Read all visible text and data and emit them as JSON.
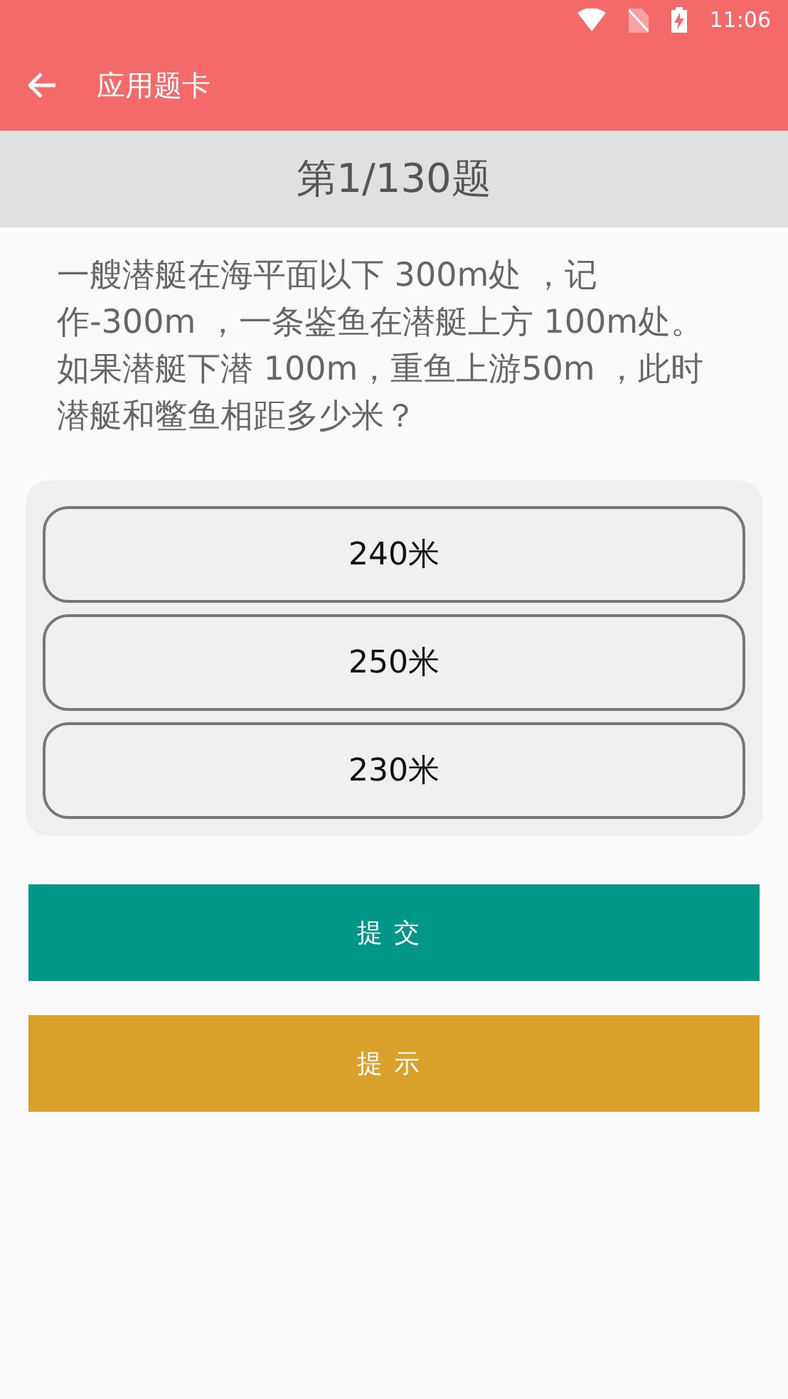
{
  "status_bar": {
    "time": "11:06"
  },
  "app_bar": {
    "title": "应用题卡"
  },
  "progress": "第1/130题",
  "question": "一艘潜艇在海平面以下 300m处 ，记作-300m ，一条鉴鱼在潜艇上方 100m处。如果潜艇下潜 100m，重鱼上游50m ，此时潜艇和鳖鱼相距多少米？",
  "options": [
    {
      "label": "240米",
      "selected": false
    },
    {
      "label": "250米",
      "selected": false
    },
    {
      "label": "230米",
      "selected": false
    }
  ],
  "buttons": [
    {
      "label": "提交",
      "kind": "submit"
    },
    {
      "label": "提示",
      "kind": "hint"
    }
  ]
}
